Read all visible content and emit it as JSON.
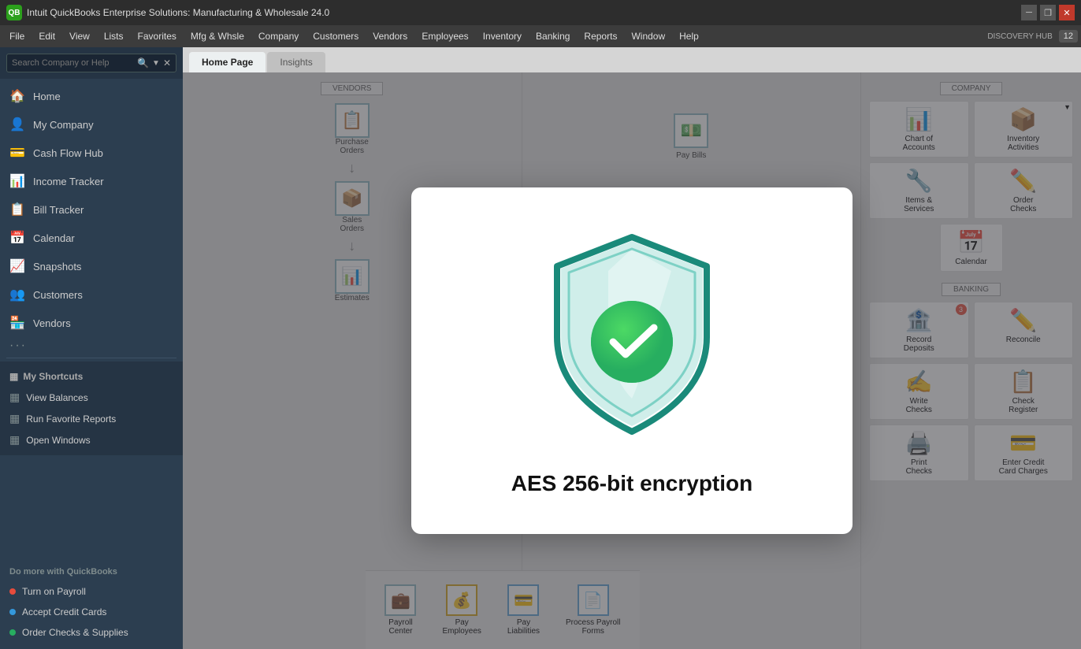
{
  "titlebar": {
    "title": "Intuit QuickBooks Enterprise Solutions: Manufacturing & Wholesale 24.0",
    "logo": "QB"
  },
  "menubar": {
    "items": [
      "File",
      "Edit",
      "View",
      "Lists",
      "Favorites",
      "Mfg & Whsle",
      "Company",
      "Customers",
      "Vendors",
      "Employees",
      "Inventory",
      "Banking",
      "Reports",
      "Window",
      "Help"
    ],
    "right": {
      "discovery": "DISCOVERY HUB",
      "time": "12"
    }
  },
  "tabs": [
    {
      "label": "Home Page",
      "active": true
    },
    {
      "label": "Insights",
      "active": false
    }
  ],
  "sidebar": {
    "search_placeholder": "Search Company or Help",
    "nav_items": [
      {
        "label": "Home",
        "icon": "🏠"
      },
      {
        "label": "My Company",
        "icon": "👤"
      },
      {
        "label": "Cash Flow Hub",
        "icon": "💳"
      },
      {
        "label": "Income Tracker",
        "icon": "📊"
      },
      {
        "label": "Bill Tracker",
        "icon": "📋"
      },
      {
        "label": "Calendar",
        "icon": "📅"
      },
      {
        "label": "Snapshots",
        "icon": "📈"
      },
      {
        "label": "Customers",
        "icon": "👥"
      },
      {
        "label": "Vendors",
        "icon": "🏪"
      }
    ],
    "shortcuts_section": {
      "header": "My Shortcuts",
      "items": [
        {
          "label": "View Balances",
          "icon": "▦"
        },
        {
          "label": "Run Favorite Reports",
          "icon": "▦"
        },
        {
          "label": "Open Windows",
          "icon": "▦"
        }
      ]
    },
    "do_more": {
      "header": "Do more with QuickBooks",
      "items": [
        {
          "label": "Turn on Payroll",
          "color": "red"
        },
        {
          "label": "Accept Credit Cards",
          "color": "blue"
        },
        {
          "label": "Order Checks & Supplies",
          "color": "green"
        }
      ]
    }
  },
  "home": {
    "vendors_section": "VENDORS",
    "company_section": "COMPANY",
    "banking_section": "BANKING",
    "flow_items": {
      "vendors": [
        {
          "label": "Purchase\nOrders",
          "icon": "📋"
        },
        {
          "label": "Sales\nOrders",
          "icon": "📦"
        },
        {
          "label": "Estimates",
          "icon": "📊"
        }
      ]
    },
    "company_icons": [
      {
        "label": "Chart of\nAccounts",
        "icon": "📊"
      },
      {
        "label": "Inventory\nActivities",
        "icon": "📦"
      },
      {
        "label": "Items &\nServices",
        "icon": "🔧"
      },
      {
        "label": "Order\nChecks",
        "icon": "✏️"
      },
      {
        "label": "Calendar",
        "icon": "📅"
      }
    ],
    "banking_icons": [
      {
        "label": "Record\nDeposits",
        "icon": "🏦",
        "badge": "3"
      },
      {
        "label": "Reconcile",
        "icon": "✏️"
      },
      {
        "label": "Write\nChecks",
        "icon": "✍️"
      },
      {
        "label": "Check\nRegister",
        "icon": "📋"
      },
      {
        "label": "Print\nChecks",
        "icon": "🖨️"
      },
      {
        "label": "Enter Credit\nCard Charges",
        "icon": "💳"
      }
    ]
  },
  "modal": {
    "title": "AES 256-bit encryption",
    "shield_colors": {
      "border": "#1a8a7a",
      "fill_light": "#e0f4f0",
      "check_bg": "#2ecc71",
      "check_border": "#27ae60"
    }
  }
}
